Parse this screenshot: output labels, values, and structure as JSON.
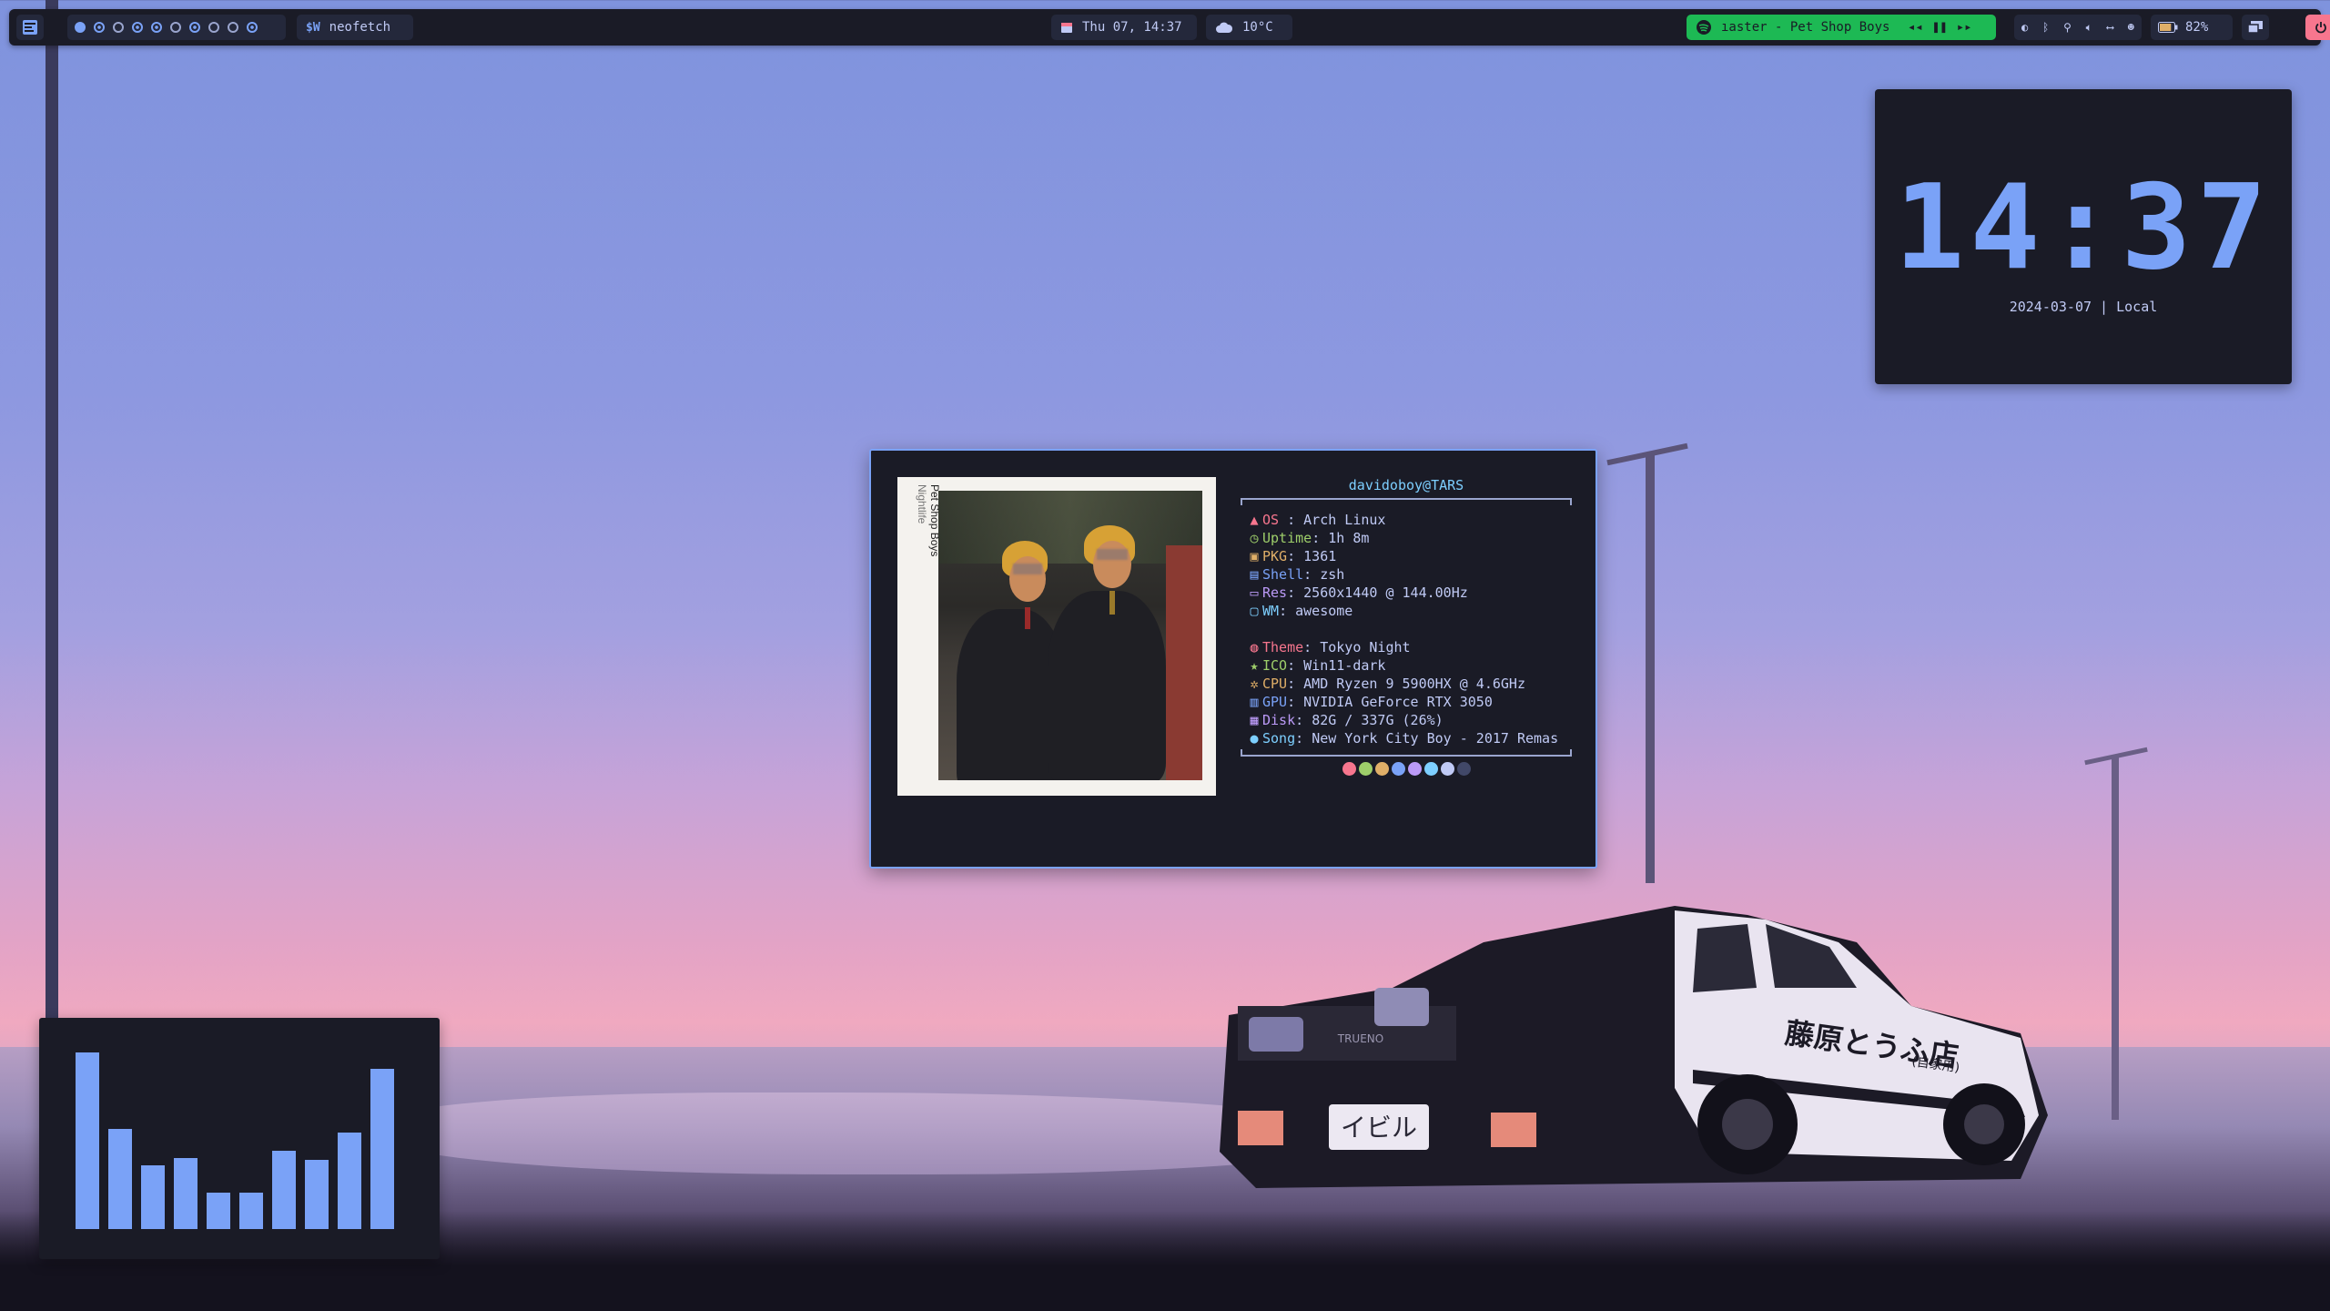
{
  "topbar": {
    "launcher_icon": "app-launcher-icon",
    "workspaces": [
      {
        "state": "focused"
      },
      {
        "state": "occupied"
      },
      {
        "state": "empty"
      },
      {
        "state": "occupied"
      },
      {
        "state": "occupied"
      },
      {
        "state": "empty"
      },
      {
        "state": "occupied"
      },
      {
        "state": "empty"
      },
      {
        "state": "empty"
      },
      {
        "state": "occupied"
      }
    ],
    "task": {
      "icon_text": "$W",
      "label": "neofetch"
    },
    "clock": {
      "icon": "calendar-icon",
      "text": "Thu 07, 14:37"
    },
    "weather": {
      "icon": "cloud-icon",
      "text": "10°C"
    },
    "music": {
      "title": "Master - Pet Shop Boys",
      "visible_title": "ıaster - Pet Shop Boys",
      "color": "#1db954"
    },
    "battery": {
      "percent": "82%",
      "level": 0.82
    },
    "accent": "#7aa2f7"
  },
  "clock_widget": {
    "time": "14:37",
    "date": "2024-03-07 | Local"
  },
  "neofetch": {
    "user_host": "davidoboy@TARS",
    "album": {
      "artist": "Pet Shop Boys",
      "title": "Nightlife"
    },
    "rows_a": [
      {
        "key": "OS",
        "sep": " : ",
        "value": "Arch Linux",
        "icon": "arch-icon",
        "color": "#f7768e"
      },
      {
        "key": "Uptime",
        "sep": ": ",
        "value": "1h 8m",
        "icon": "clock-icon",
        "color": "#9ece6a"
      },
      {
        "key": "PKG",
        "sep": ": ",
        "value": "1361",
        "icon": "package-icon",
        "color": "#e0af68"
      },
      {
        "key": "Shell",
        "sep": ": ",
        "value": "zsh",
        "icon": "terminal-icon",
        "color": "#7aa2f7"
      },
      {
        "key": "Res",
        "sep": ": ",
        "value": "2560x1440 @ 144.00Hz",
        "icon": "monitor-icon",
        "color": "#bb9af7"
      },
      {
        "key": "WM",
        "sep": ": ",
        "value": "awesome",
        "icon": "window-icon",
        "color": "#7dcfff"
      }
    ],
    "rows_b": [
      {
        "key": "Theme",
        "sep": ": ",
        "value": "Tokyo Night",
        "icon": "palette-icon",
        "color": "#f7768e"
      },
      {
        "key": "ICO",
        "sep": ": ",
        "value": "Win11-dark",
        "icon": "star-icon",
        "color": "#9ece6a"
      },
      {
        "key": "CPU",
        "sep": ": ",
        "value": "AMD Ryzen 9 5900HX @ 4.6GHz",
        "icon": "cpu-icon",
        "color": "#e0af68"
      },
      {
        "key": "GPU",
        "sep": ": ",
        "value": "NVIDIA GeForce RTX 3050",
        "icon": "gpu-icon",
        "color": "#7aa2f7"
      },
      {
        "key": "Disk",
        "sep": ": ",
        "value": "82G / 337G (26%)",
        "icon": "disk-icon",
        "color": "#bb9af7"
      },
      {
        "key": "Song",
        "sep": ": ",
        "value": "New York City Boy - 2017 Remas",
        "icon": "music-icon",
        "color": "#7dcfff"
      }
    ],
    "palette": [
      "#f7768e",
      "#9ece6a",
      "#e0af68",
      "#7aa2f7",
      "#bb9af7",
      "#7dcfff",
      "#c0caf5",
      "#414868"
    ]
  },
  "visualizer": {
    "bar_color": "#7aa2f7",
    "levels": [
      0.97,
      0.55,
      0.35,
      0.39,
      0.2,
      0.2,
      0.43,
      0.38,
      0.53,
      0.88
    ]
  },
  "wallpaper": {
    "car_plate": "イビル",
    "car_text": "藤原とうふ店",
    "car_text_small": "(自家用)",
    "car_grille_text": "TRUENO"
  }
}
